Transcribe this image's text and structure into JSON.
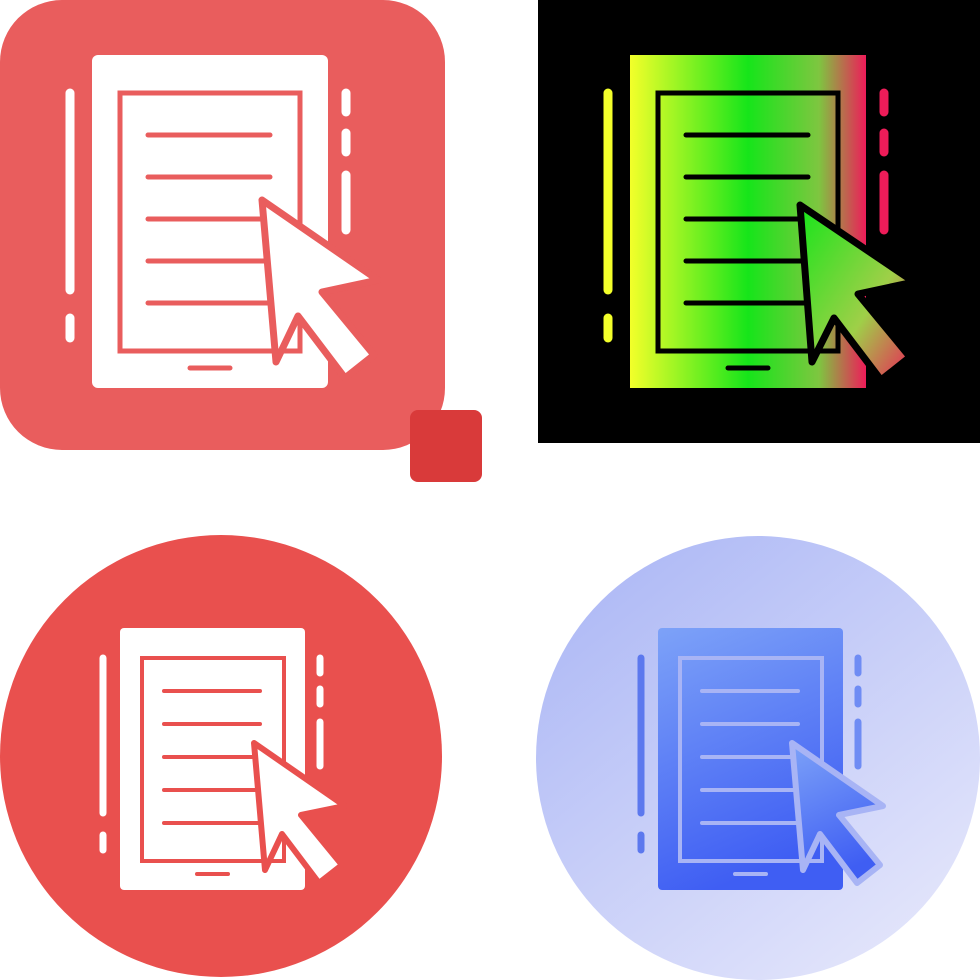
{
  "icons": [
    {
      "id": "variant-red-rounded",
      "icon": "tablet-document-cursor-icon",
      "style": "flat-rounded-square",
      "colors": {
        "background": "#e95d5d",
        "foreground": "#ffffff",
        "accent": "#d93a3a"
      }
    },
    {
      "id": "variant-gradient-dark",
      "icon": "tablet-document-cursor-icon",
      "style": "gradient-on-black",
      "colors": {
        "background": "#000000",
        "gradient_start": "#f3ff2a",
        "gradient_mid": "#16e51a",
        "gradient_end": "#ee1c59",
        "outline": "#000000"
      }
    },
    {
      "id": "variant-red-circle",
      "icon": "tablet-document-cursor-icon",
      "style": "flat-circle",
      "colors": {
        "background": "#e9504e",
        "foreground": "#ffffff"
      }
    },
    {
      "id": "variant-blue-circle",
      "icon": "tablet-document-cursor-icon",
      "style": "gradient-circle",
      "colors": {
        "background_start": "#a8b4f5",
        "background_end": "#e4e6fb",
        "gradient_start": "#6c88f6",
        "gradient_end": "#3f5ef3",
        "outline": "#5a74e4"
      }
    }
  ]
}
